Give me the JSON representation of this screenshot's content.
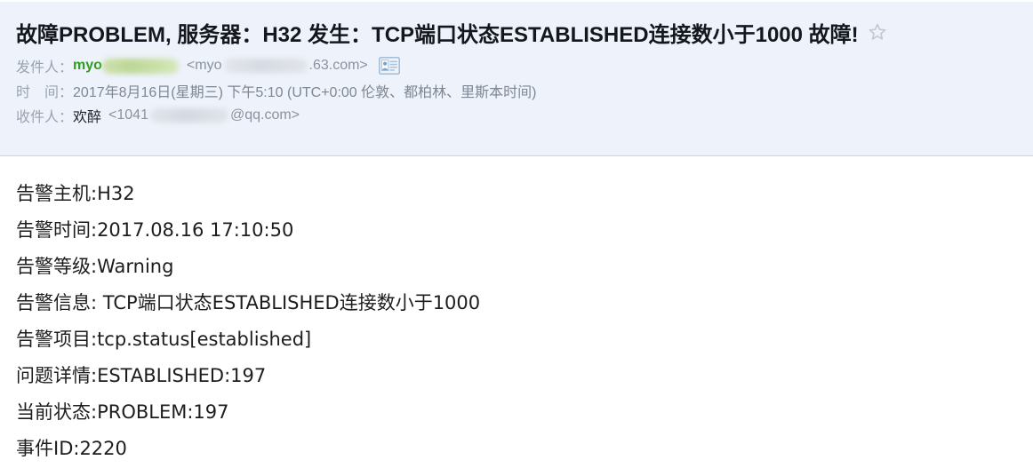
{
  "header": {
    "subject": "故障PROBLEM, 服务器：H32 发生：TCP端口状态ESTABLISHED连接数小于1000 故障!",
    "star_icon": "star-outline-icon",
    "sender": {
      "label": "发件人：",
      "display_name": "myo",
      "address_prefix": "<myo",
      "address_suffix": ".63.com>",
      "contact_card_icon": "contact-card-icon"
    },
    "date": {
      "label": "时　间：",
      "value": "2017年8月16日(星期三) 下午5:10 (UTC+0:00 伦敦、都柏林、里斯本时间)"
    },
    "recipient": {
      "label": "收件人：",
      "display_name": "欢醉",
      "address_prefix": "<1041",
      "address_suffix": "@qq.com>"
    }
  },
  "body": {
    "lines": [
      "告警主机:H32",
      "告警时间:2017.08.16 17:10:50",
      "告警等级:Warning",
      "告警信息: TCP端口状态ESTABLISHED连接数小于1000",
      "告警项目:tcp.status[established]",
      "问题详情:ESTABLISHED:197",
      "当前状态:PROBLEM:197",
      "事件ID:2220"
    ]
  },
  "colors": {
    "header_background": "#eef2fa",
    "header_border": "#c9d4e8",
    "sender_accent": "#2f9b21",
    "meta_text": "#8a94a6",
    "body_text": "#1d1d1d",
    "subject_text": "#14181e"
  }
}
